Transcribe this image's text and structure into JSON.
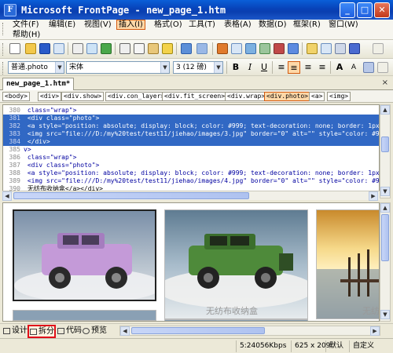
{
  "window": {
    "title": "Microsoft FrontPage - new_page_1.htm",
    "app_icon_letter": "F",
    "minimize": "_",
    "maximize": "□",
    "close": "✕"
  },
  "menu": {
    "items": [
      "文件(F)",
      "编辑(E)",
      "视图(V)",
      "插入(I)",
      "格式(O)",
      "工具(T)",
      "表格(A)",
      "数据(D)",
      "框架(R)",
      "窗口(W)"
    ],
    "help": "帮助(H)"
  },
  "formatting": {
    "style": "普通.photo",
    "font": "宋体",
    "size": "3 (12 磅)",
    "bold": "B",
    "italic": "I",
    "underline": "U"
  },
  "document_tab": {
    "label": "new_page_1.htm*",
    "close": "×"
  },
  "tag_selector": [
    "<body>",
    "<div>",
    "<div.show>",
    "<div.con_layer>",
    "<div.fit_screen>",
    "<div.wrap>",
    "<div.photo>",
    "<a>",
    "<img>"
  ],
  "code": {
    "lines": [
      {
        "n": "380",
        "text": "    class=\"wrap\">",
        "hl": false
      },
      {
        "n": "381",
        "text": "    <div class=\"photo\">",
        "hl": true
      },
      {
        "n": "382",
        "text": "        <a style=\"position: absolute; display: block; color: #999; text-decoration: none; border: 1px",
        "hl": true
      },
      {
        "n": "383",
        "text": "        <img src=\"file:///D:/my%20test/test11/jiehao/images/3.jpg\" border=\"0\" alt=\"\" style=\"color: #99",
        "hl": true
      },
      {
        "n": "384",
        "text": "    </div>",
        "hl": true
      },
      {
        "n": "385",
        "text": "v>",
        "hl": false
      },
      {
        "n": "386",
        "text": "    class=\"wrap\">",
        "hl": false
      },
      {
        "n": "387",
        "text": "    <div class=\"photo\">",
        "hl": false
      },
      {
        "n": "388",
        "text": "        <a style=\"position: absolute; display: block; color: #999; text-decoration: none; border: 1px",
        "hl": false
      },
      {
        "n": "389",
        "text": "        <img src=\"file:///D:/my%20test/test11/jiehao/images/4.jpg\" border=\"0\" alt=\"\" style=\"color: #99",
        "hl": false
      },
      {
        "n": "390",
        "text": "        无纺布收纳盒</a></div>",
        "hl": false
      }
    ]
  },
  "design": {
    "photo_label_1": "无纺布收纳盒",
    "photo_label_2": "无纺"
  },
  "views": {
    "design": "设计",
    "split": "拆分",
    "code": "代码",
    "preview": "预览"
  },
  "status": {
    "speed": "5:24056Kbps",
    "dimensions": "625 x 209",
    "default": "默认",
    "custom": "自定义"
  },
  "colors": {
    "selection": "#3168c4",
    "split_highlight": "#e0101a",
    "title_bar": "#0842b8"
  }
}
